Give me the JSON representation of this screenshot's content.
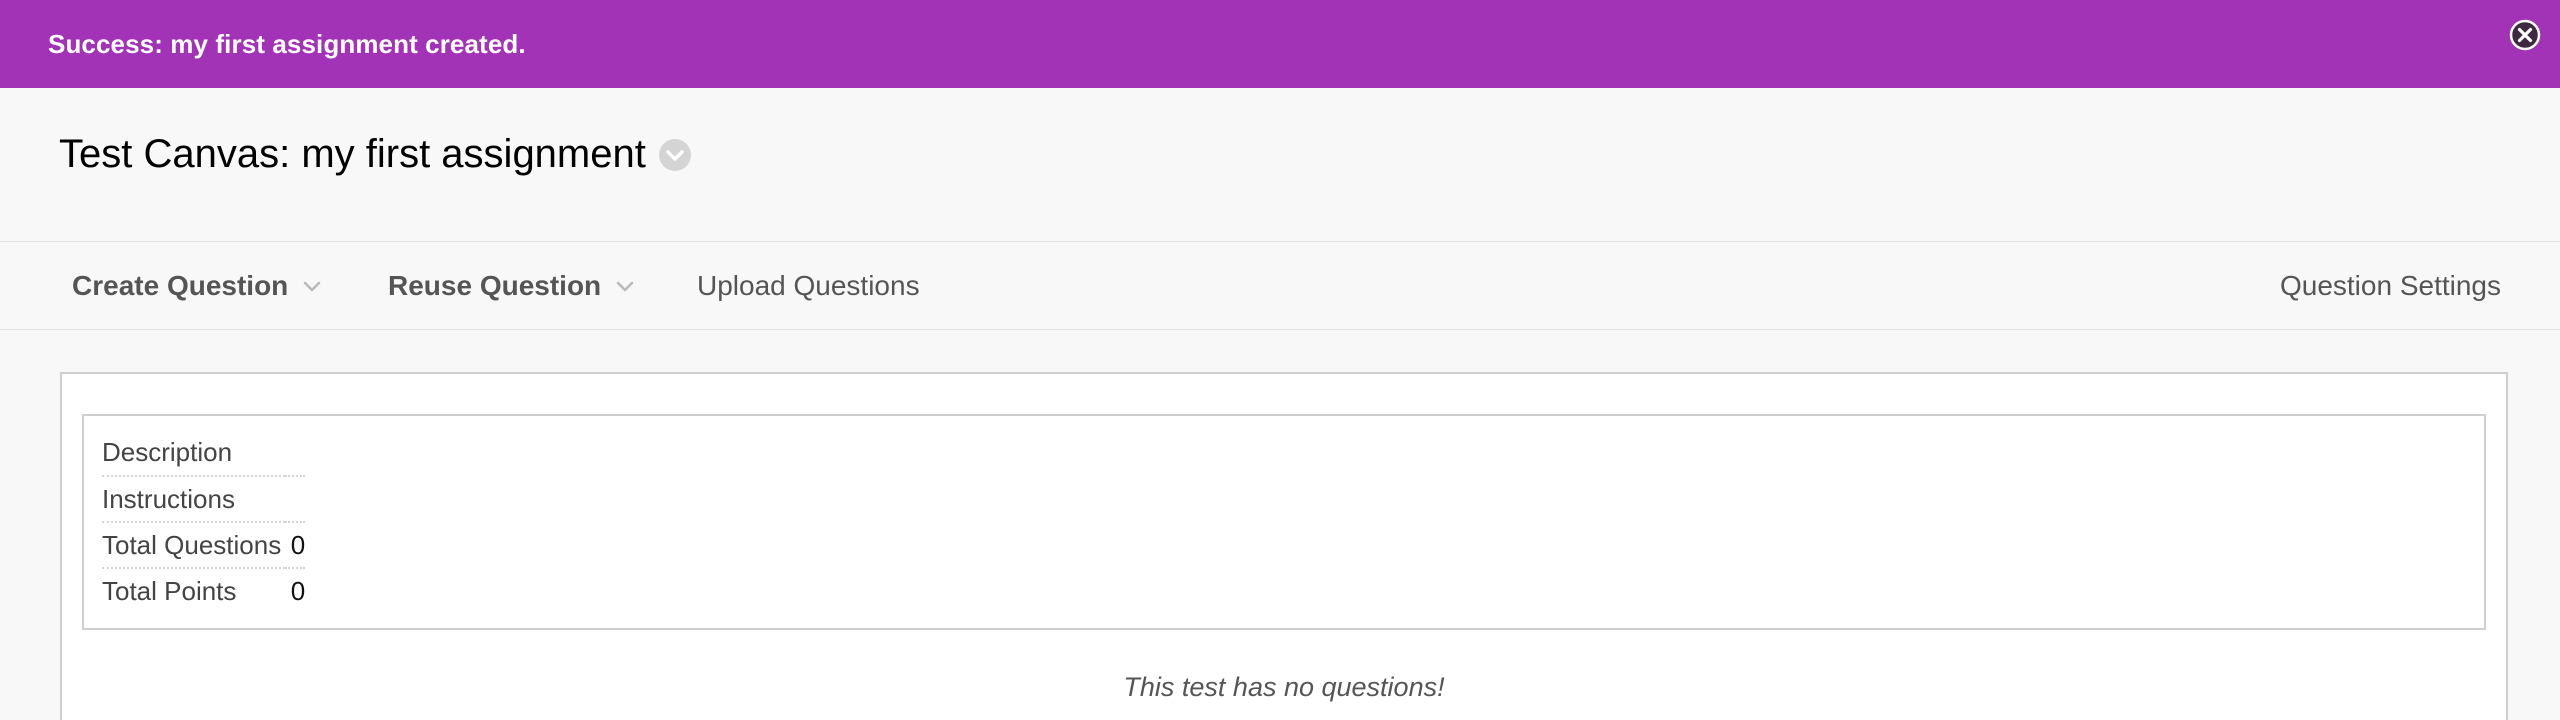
{
  "banner": {
    "message": "Success: my first assignment created.",
    "bg_color": "#a233b7",
    "close_icon": "close-circle-icon"
  },
  "header": {
    "title": "Test Canvas: my first assignment",
    "menu_icon": "chevron-down-circle-icon"
  },
  "action_bar": {
    "create_question": "Create Question",
    "reuse_question": "Reuse Question",
    "upload_questions": "Upload Questions",
    "question_settings": "Question Settings"
  },
  "info": {
    "rows": [
      {
        "label": "Description",
        "value": ""
      },
      {
        "label": "Instructions",
        "value": ""
      },
      {
        "label": "Total Questions",
        "value": "0"
      },
      {
        "label": "Total Points",
        "value": "0"
      }
    ]
  },
  "empty_message": "This test has no questions!"
}
